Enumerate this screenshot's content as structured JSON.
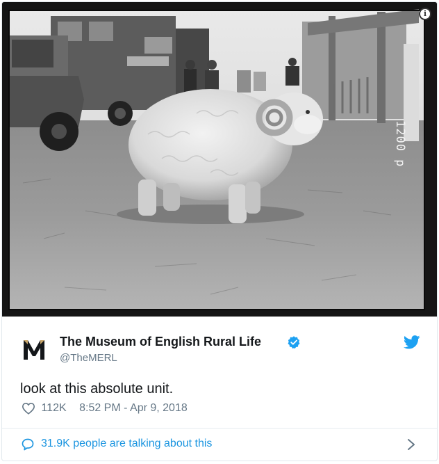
{
  "media": {
    "alt_icon": "info-icon",
    "plate_number": "1200 p",
    "info_button": "i"
  },
  "account": {
    "display_name": "The Museum of English Rural Life",
    "handle": "@TheMERL",
    "logo_letter": "M",
    "verified_icon": "verified-badge-icon",
    "platform_icon": "twitter-bird-icon"
  },
  "tweet": {
    "text": "look at this absolute unit.",
    "likes": "112K",
    "timestamp": "8:52 PM - Apr 9, 2018"
  },
  "footer": {
    "conversation": "31.9K people are talking about this"
  },
  "colors": {
    "twitter_blue": "#1da1f2",
    "link_blue": "#1b95e0",
    "text_primary": "#14171a",
    "text_secondary": "#657786"
  }
}
